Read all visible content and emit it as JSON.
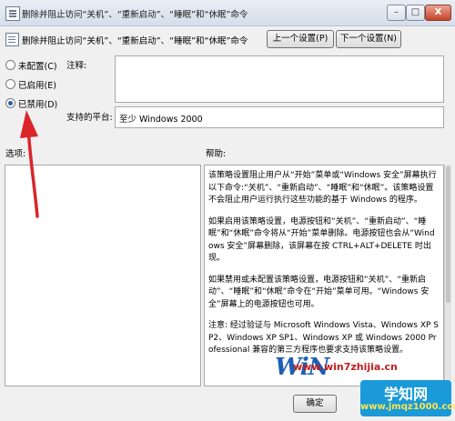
{
  "window": {
    "title": "删除并阻止访问“关机”、“重新启动”、“睡眠”和“休眠”命令",
    "controls": {
      "minimize": "–",
      "maximize": "□",
      "close": "X"
    }
  },
  "policy": {
    "name": "删除并阻止访问“关机”、“重新启动”、“睡眠”和“休眠”命令"
  },
  "nav": {
    "prev_label": "上一个设置(P)",
    "next_label": "下一个设置(N)"
  },
  "state": {
    "options": [
      {
        "label": "未配置(C)",
        "checked": false
      },
      {
        "label": "已启用(E)",
        "checked": false
      },
      {
        "label": "已禁用(D)",
        "checked": true
      }
    ]
  },
  "fields": {
    "comment_label": "注释:",
    "comment_value": "",
    "platform_label": "支持的平台:",
    "platform_value": "至少 Windows 2000"
  },
  "panes": {
    "options_label": "选项:",
    "help_label": "帮助:"
  },
  "help": {
    "paragraphs": [
      "该策略设置阻止用户从“开始”菜单或“Windows 安全”屏幕执行以下命令:“关机”、“重新启动”、“睡眠”和“休眠”。该策略设置不会阻止用户运行执行这些功能的基于 Windows 的程序。",
      "如果启用该策略设置，电源按钮和“关机”、“重新启动”、“睡眠”和“休眠”命令将从“开始”菜单删除。电源按钮也会从“Windows 安全”屏幕删除，该屏幕在按 CTRL+ALT+DELETE 时出现。",
      "如果禁用或未配置该策略设置，电源按钮和“关机”、“重新启动”、“睡眠”和“休眠”命令在“开始”菜单可用。“Windows 安全”屏幕上的电源按钮也可用。",
      "注意: 经过验证与 Microsoft Windows Vista、Windows XP SP2、Windows XP SP1、Windows XP 或 Windows 2000 Professional 兼容的第三方程序也要求支持该策略设置。"
    ]
  },
  "footer": {
    "ok_label": "确定"
  },
  "watermark": {
    "win": "WiN",
    "url": "www.win7zhijia.cn",
    "badge_name": "学知网",
    "badge_site": "www.jmqz1000.com"
  },
  "colors": {
    "annotation_arrow": "#d9262b",
    "selected_radio": "#2a5db0"
  }
}
